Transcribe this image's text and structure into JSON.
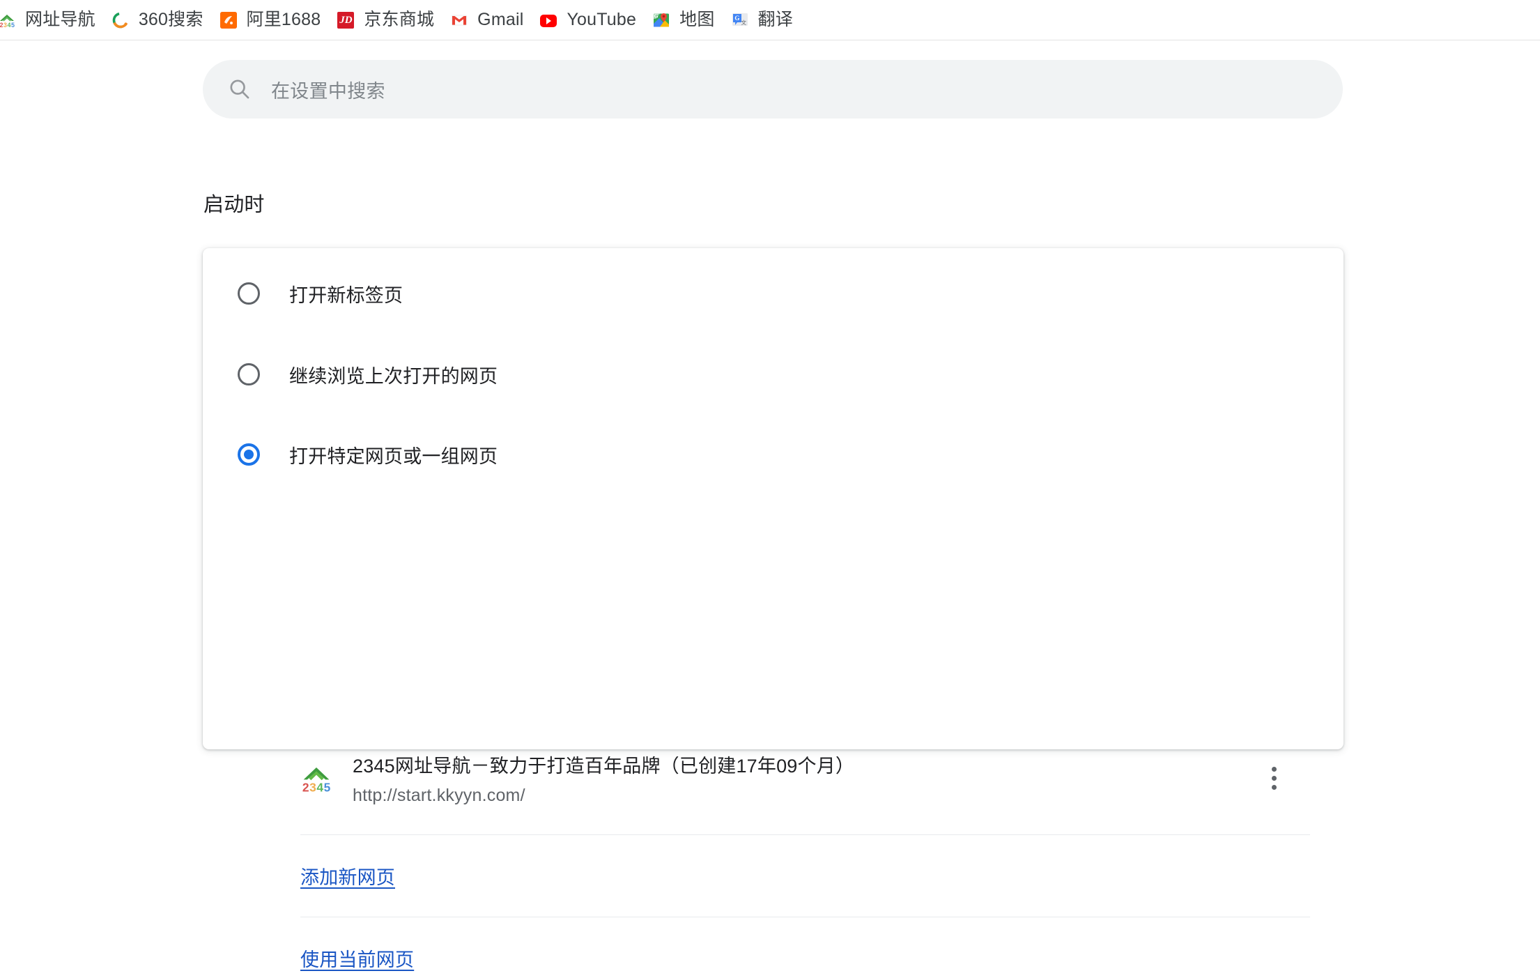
{
  "colors": {
    "accent": "#1a73e8",
    "link": "#1a56c4",
    "text_primary": "#202124",
    "text_secondary": "#5f6368",
    "search_bg": "#f1f3f4",
    "card_bg": "#ffffff",
    "separator": "#e8eaed",
    "page_bg": "#ffffff"
  },
  "bookmarks_bar": {
    "items": [
      {
        "label": "网址导航",
        "icon": "2345-navigation-icon"
      },
      {
        "label": "360搜索",
        "icon": "360-search-icon"
      },
      {
        "label": "阿里1688",
        "icon": "alibaba-1688-icon"
      },
      {
        "label": "京东商城",
        "icon": "jd-mall-icon",
        "icon_text": "JD"
      },
      {
        "label": "Gmail",
        "icon": "gmail-icon"
      },
      {
        "label": "YouTube",
        "icon": "youtube-icon"
      },
      {
        "label": "地图",
        "icon": "google-maps-icon"
      },
      {
        "label": "翻译",
        "icon": "google-translate-icon"
      }
    ]
  },
  "search": {
    "placeholder": "在设置中搜索",
    "value": "",
    "icon": "search-icon"
  },
  "settings": {
    "section_heading": "启动时",
    "startup_options": [
      {
        "label": "打开新标签页",
        "selected": false
      },
      {
        "label": "继续浏览上次打开的网页",
        "selected": false
      },
      {
        "label": "打开特定网页或一组网页",
        "selected": true
      }
    ],
    "startup_pages": [
      {
        "title": "2345网址导航－致力于打造百年品牌（已创建17年09个月）",
        "url": "http://start.kkyyn.com/",
        "favicon": "2345-navigation-icon",
        "menu_icon": "more-vertical-icon"
      }
    ],
    "actions": {
      "add_new_page": "添加新网页",
      "use_current_pages": "使用当前网页"
    }
  }
}
